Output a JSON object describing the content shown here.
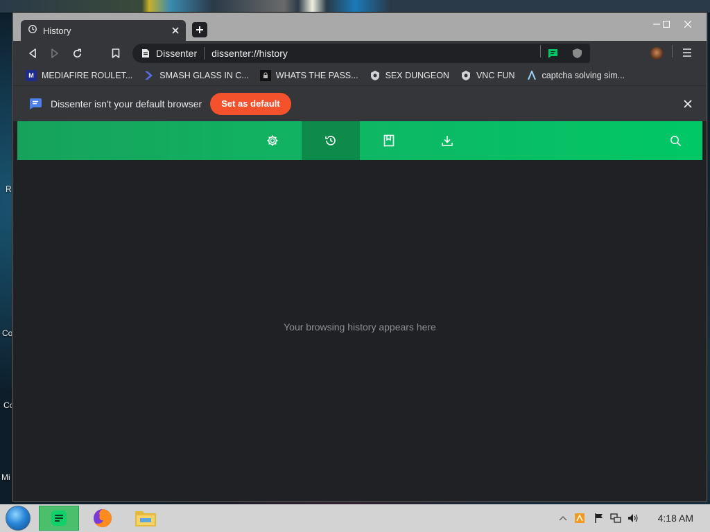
{
  "desktop": {
    "labels": [
      "R",
      "Co",
      "Co",
      "Mi"
    ]
  },
  "browser": {
    "tab": {
      "title": "History",
      "icon": "history-icon"
    },
    "window_controls": [
      "minimize-icon",
      "maximize-icon",
      "close-icon"
    ],
    "omnibox": {
      "site_name": "Dissenter",
      "url": "dissenter://history"
    },
    "bookmarks": [
      {
        "label": "MEDIAFIRE ROULET...",
        "icon": "mediafire-icon"
      },
      {
        "label": "SMASH GLASS IN C...",
        "icon": "smash-glass-icon"
      },
      {
        "label": "WHATS THE PASS...",
        "icon": "password-icon"
      },
      {
        "label": "SEX DUNGEON",
        "icon": "dungeon-icon"
      },
      {
        "label": "VNC FUN",
        "icon": "vnc-icon"
      },
      {
        "label": "captcha solving sim...",
        "icon": "captcha-icon"
      }
    ],
    "infobar": {
      "message": "Dissenter isn't your default browser",
      "button": "Set as default"
    },
    "nav": [
      "settings-icon",
      "history-icon",
      "bookmarks-icon",
      "downloads-icon",
      "search-icon"
    ],
    "empty_message": "Your browsing history appears here",
    "colors": {
      "accent": "#00c866",
      "cta": "#f4522d"
    }
  },
  "taskbar": {
    "apps": [
      "dissenter-app-icon",
      "firefox-icon",
      "file-explorer-icon"
    ],
    "clock": "4:18 AM"
  }
}
